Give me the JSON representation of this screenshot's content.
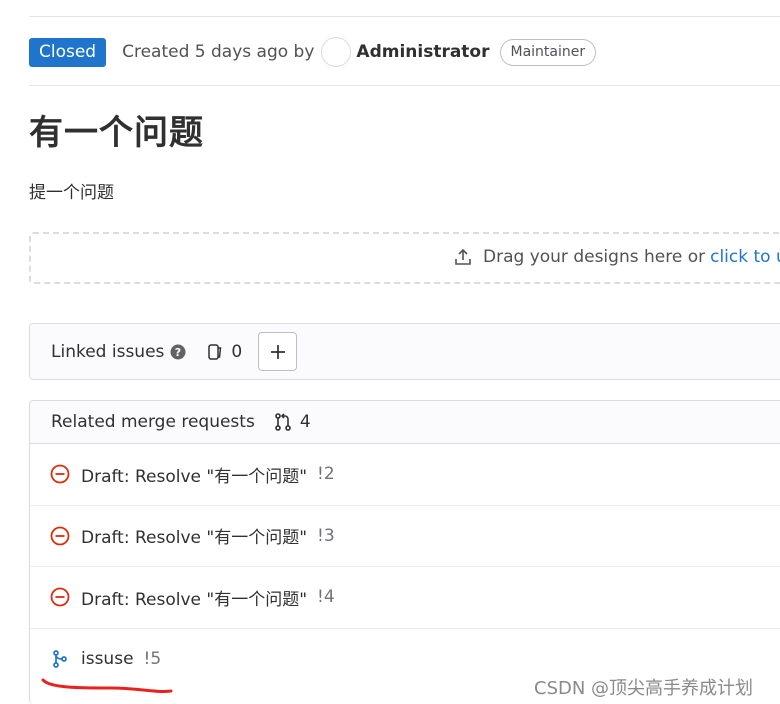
{
  "issue": {
    "status": "Closed",
    "created_text": "Created 5 days ago by",
    "author": "Administrator",
    "author_role": "Maintainer",
    "title": "有一个问题",
    "description": "提一个问题"
  },
  "design_upload": {
    "prompt": "Drag your designs here or",
    "link": "click to uplo"
  },
  "linked_issues": {
    "title": "Linked issues",
    "count": "0",
    "add_label": "+"
  },
  "related_mrs": {
    "title": "Related merge requests",
    "count": "4",
    "items": [
      {
        "title": "Draft: Resolve \"有一个问题\"",
        "ref": "!2",
        "state": "closed"
      },
      {
        "title": "Draft: Resolve \"有一个问题\"",
        "ref": "!3",
        "state": "closed"
      },
      {
        "title": "Draft: Resolve \"有一个问题\"",
        "ref": "!4",
        "state": "closed"
      },
      {
        "title": "issuse",
        "ref": "!5",
        "state": "merged"
      }
    ]
  },
  "watermark": "CSDN @顶尖高手养成计划",
  "colors": {
    "accent": "#1f75cb",
    "closed_red": "#dd2b0e",
    "annotation_red": "#e8231f"
  }
}
